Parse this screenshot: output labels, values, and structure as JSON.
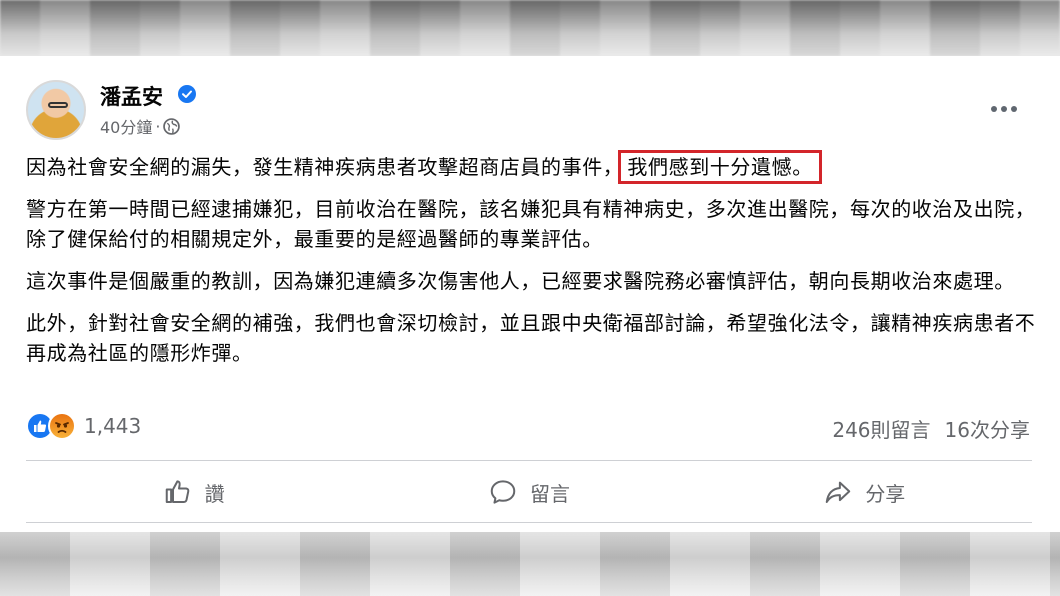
{
  "post": {
    "author": "潘孟安",
    "time": "40分鐘",
    "separator": "·",
    "paragraphs": [
      {
        "before": "因為社會安全網的漏失，發生精神疾病患者攻擊超商店員的事件，",
        "highlight": "我們感到十分遺憾。"
      },
      "警方在第一時間已經逮捕嫌犯，目前收治在醫院，該名嫌犯具有精神病史，多次進出醫院，每次的收治及出院，除了健保給付的相關規定外，最重要的是經過醫師的專業評估。",
      "這次事件是個嚴重的教訓，因為嫌犯連續多次傷害他人，已經要求醫院務必審慎評估，朝向長期收治來處理。",
      "此外，針對社會安全網的補強，我們也會深切檢討，並且跟中央衛福部討論，希望強化法令，讓精神疾病患者不再成為社區的隱形炸彈。"
    ],
    "reactions": {
      "count": "1,443",
      "icons": [
        "like-icon",
        "angry-icon"
      ]
    },
    "comments": "246則留言",
    "shares": "16次分享"
  },
  "actions": {
    "like": "讚",
    "comment": "留言",
    "share": "分享"
  },
  "colors": {
    "verified": "#1877f2",
    "highlight_border": "#d3252a",
    "muted_text": "#65676b"
  }
}
